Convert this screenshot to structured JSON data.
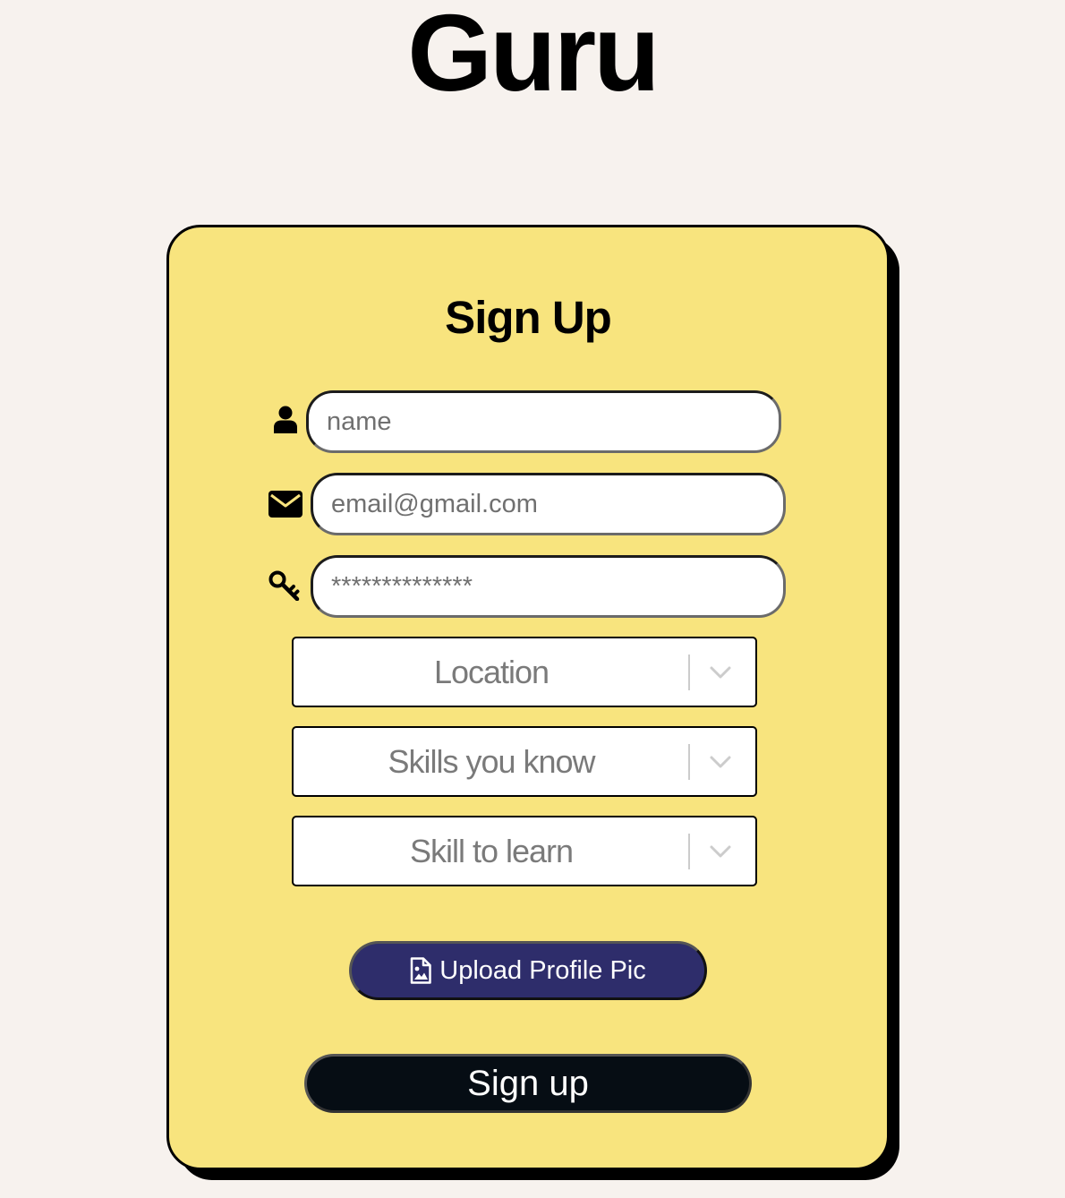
{
  "app": {
    "title": "Guru"
  },
  "form": {
    "heading": "Sign Up",
    "name": {
      "placeholder": "name",
      "value": "",
      "icon": "user-icon"
    },
    "email": {
      "placeholder": "email@gmail.com",
      "value": "",
      "icon": "envelope-icon"
    },
    "password": {
      "placeholder": "**************",
      "value": "",
      "icon": "key-icon"
    },
    "selects": {
      "location": {
        "placeholder": "Location",
        "icon": "chevron-down-icon"
      },
      "skills_known": {
        "placeholder": "Skills you know",
        "icon": "chevron-down-icon"
      },
      "skill_to_learn": {
        "placeholder": "Skill to learn",
        "icon": "chevron-down-icon"
      }
    },
    "upload_button": {
      "label": "Upload Profile Pic",
      "icon": "image-file-icon"
    },
    "submit_button": {
      "label": "Sign up"
    }
  },
  "colors": {
    "page_background": "#f7f2ee",
    "card_background": "#f8e47e",
    "upload_button": "#2e2d6b",
    "submit_button": "#060d14"
  }
}
